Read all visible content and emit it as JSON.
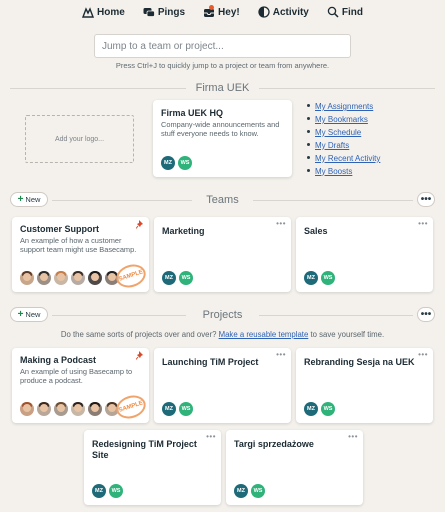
{
  "nav": {
    "home": "Home",
    "pings": "Pings",
    "hey": "Hey!",
    "activity": "Activity",
    "find": "Find"
  },
  "jump": {
    "placeholder": "Jump to a team or project...",
    "hint": "Press Ctrl+J to quickly jump to a project or team from anywhere."
  },
  "company": {
    "name": "Firma UEK",
    "logo_placeholder": "Add your logo...",
    "hq": {
      "title": "Firma UEK HQ",
      "description": "Company-wide announcements and stuff everyone needs to know.",
      "avatars": [
        "MZ",
        "WS"
      ]
    },
    "quick_links": [
      "My Assignments",
      "My Bookmarks",
      "My Schedule",
      "My Drafts",
      "My Recent Activity",
      "My Boosts"
    ]
  },
  "teams": {
    "heading": "Teams",
    "new_label": "New",
    "cards": [
      {
        "title": "Customer Support",
        "description": "An example of how a customer support team might use Basecamp.",
        "sample": "SAMPLE"
      },
      {
        "title": "Marketing",
        "avatars": [
          "MZ",
          "WS"
        ]
      },
      {
        "title": "Sales",
        "avatars": [
          "MZ",
          "WS"
        ]
      }
    ]
  },
  "projects": {
    "heading": "Projects",
    "new_label": "New",
    "note_prefix": "Do the same sorts of projects over and over?",
    "note_link": "Make a reusable template",
    "note_suffix": "to save yourself time.",
    "cards": [
      {
        "title": "Making a Podcast",
        "description": "An example of using Basecamp to produce a podcast.",
        "sample": "SAMPLE"
      },
      {
        "title": "Launching TiM Project",
        "avatars": [
          "MZ",
          "WS"
        ]
      },
      {
        "title": "Rebranding Sesja na UEK",
        "avatars": [
          "MZ",
          "WS"
        ]
      },
      {
        "title": "Redesigning TiM Project Site",
        "avatars": [
          "MZ",
          "WS"
        ]
      },
      {
        "title": "Targi sprzedażowe",
        "avatars": [
          "MZ",
          "WS"
        ]
      }
    ]
  },
  "colors": {
    "background": "#f4f1ec",
    "link": "#2e62b5",
    "avatar_mz": "#1f6a78",
    "avatar_ws": "#2fb37a",
    "sample_stamp": "#f08c43",
    "new_plus": "#1e8a4d"
  },
  "icons": {
    "home": "home-icon",
    "pings": "pings-icon",
    "hey": "hey-icon",
    "activity": "activity-icon",
    "find": "search-icon",
    "pin": "pin-icon",
    "more": "more-icon"
  }
}
